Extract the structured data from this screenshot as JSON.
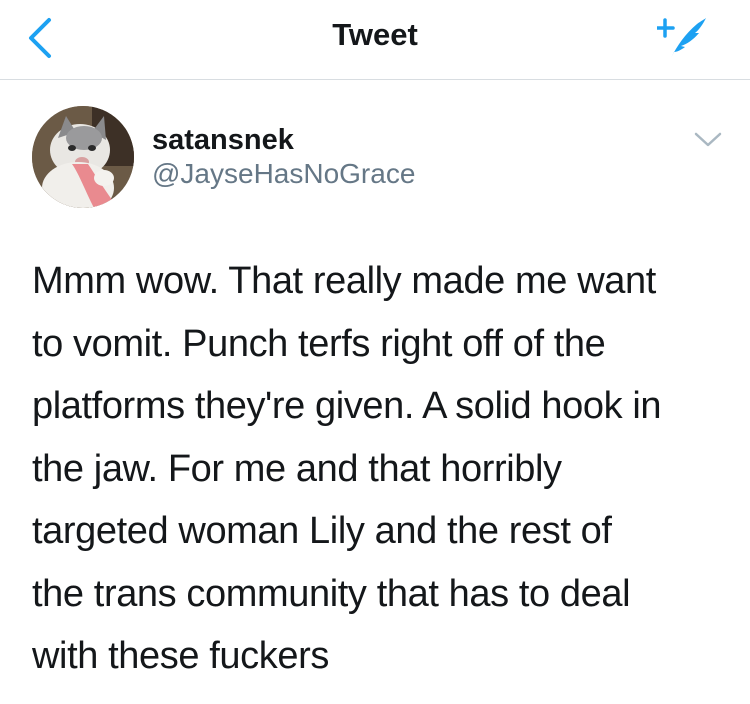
{
  "header": {
    "title": "Tweet",
    "back_icon": "chevron-left-icon",
    "compose_icon": "compose-tweet-icon",
    "accent_color": "#1da1f2"
  },
  "tweet": {
    "author": {
      "display_name": "satansnek",
      "handle": "@JayseHasNoGrace",
      "avatar": "cat-photo-avatar"
    },
    "menu_icon": "chevron-down-icon",
    "text_lines": [
      "Mmm wow. That really made me want",
      "to vomit. Punch terfs right off of the",
      "platforms they're given. A solid hook in",
      "the jaw. For me and that horribly",
      "targeted woman Lily and the rest of",
      "the trans community that has to deal",
      "with these fuckers"
    ]
  }
}
